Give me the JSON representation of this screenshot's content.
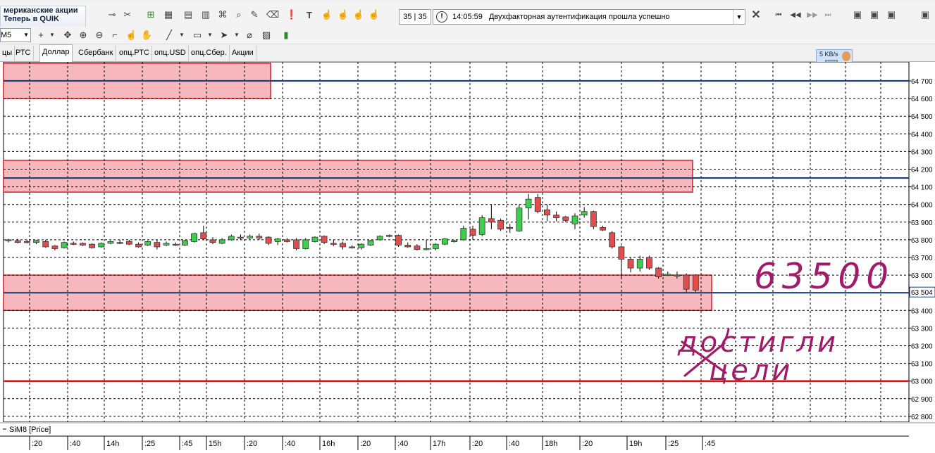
{
  "toolbar": {
    "promo_line1": "мериканские акции",
    "promo_line2": "Теперь в QUIK",
    "counter": "35 | 35",
    "message_time": "14:05:59",
    "message_text": "Двухфакторная аутентификация прошла успешно"
  },
  "toolbar2": {
    "interval": "M5"
  },
  "tabs": [
    "цы",
    "РТС",
    "Доллар",
    "Сбербанк",
    "опц.РТС",
    "опц.USD",
    "опц.Сбер.",
    "Акции"
  ],
  "active_tab": 2,
  "speed_indicator": "5 KB/s",
  "bottom_label": "SiM8 [Price]",
  "price_axis": [
    "64 700",
    "64 600",
    "64 500",
    "64 400",
    "64 300",
    "64 200",
    "64 100",
    "64 000",
    "63 900",
    "63 800",
    "63 700",
    "63 600",
    "63 400",
    "63 300",
    "63 200",
    "63 100",
    "63 000",
    "62 900",
    "62 800"
  ],
  "current_price_label": "63 504",
  "time_axis": [
    ":20",
    ":40",
    "14h",
    ":25",
    ":45",
    "15h",
    ":20",
    ":40",
    "16h",
    ":20",
    ":40",
    "17h",
    ":20",
    ":40",
    "18h",
    ":20",
    "19h",
    ":25",
    ":45"
  ],
  "annotations": {
    "price_note": "63500",
    "text_note_1": "достигли",
    "text_note_2": "цели"
  },
  "chart_data": {
    "type": "candlestick",
    "instrument": "SiM8",
    "ylim": [
      62770,
      64800
    ],
    "levels_blue": [
      64700,
      64150,
      63500
    ],
    "level_red": 63000,
    "zones": [
      {
        "y_top": 64800,
        "y_bottom": 64600
      },
      {
        "y_top": 64250,
        "y_bottom": 64070
      },
      {
        "y_top": 63600,
        "y_bottom": 63400
      }
    ],
    "candles": [
      {
        "o": 63795,
        "h": 63805,
        "l": 63785,
        "c": 63800
      },
      {
        "o": 63795,
        "h": 63805,
        "l": 63780,
        "c": 63785
      },
      {
        "o": 63790,
        "h": 63800,
        "l": 63780,
        "c": 63785
      },
      {
        "o": 63785,
        "h": 63800,
        "l": 63775,
        "c": 63795
      },
      {
        "o": 63790,
        "h": 63800,
        "l": 63755,
        "c": 63760
      },
      {
        "o": 63765,
        "h": 63770,
        "l": 63740,
        "c": 63750
      },
      {
        "o": 63755,
        "h": 63790,
        "l": 63750,
        "c": 63785
      },
      {
        "o": 63780,
        "h": 63790,
        "l": 63770,
        "c": 63775
      },
      {
        "o": 63780,
        "h": 63785,
        "l": 63765,
        "c": 63770
      },
      {
        "o": 63775,
        "h": 63780,
        "l": 63750,
        "c": 63755
      },
      {
        "o": 63760,
        "h": 63785,
        "l": 63755,
        "c": 63780
      },
      {
        "o": 63780,
        "h": 63795,
        "l": 63775,
        "c": 63790
      },
      {
        "o": 63785,
        "h": 63800,
        "l": 63775,
        "c": 63780
      },
      {
        "o": 63790,
        "h": 63800,
        "l": 63770,
        "c": 63775
      },
      {
        "o": 63775,
        "h": 63785,
        "l": 63755,
        "c": 63760
      },
      {
        "o": 63770,
        "h": 63795,
        "l": 63765,
        "c": 63790
      },
      {
        "o": 63785,
        "h": 63800,
        "l": 63745,
        "c": 63760
      },
      {
        "o": 63770,
        "h": 63790,
        "l": 63765,
        "c": 63780
      },
      {
        "o": 63775,
        "h": 63785,
        "l": 63765,
        "c": 63770
      },
      {
        "o": 63770,
        "h": 63800,
        "l": 63765,
        "c": 63795
      },
      {
        "o": 63790,
        "h": 63840,
        "l": 63785,
        "c": 63835
      },
      {
        "o": 63840,
        "h": 63880,
        "l": 63800,
        "c": 63805
      },
      {
        "o": 63800,
        "h": 63815,
        "l": 63775,
        "c": 63785
      },
      {
        "o": 63780,
        "h": 63810,
        "l": 63775,
        "c": 63800
      },
      {
        "o": 63800,
        "h": 63830,
        "l": 63795,
        "c": 63820
      },
      {
        "o": 63815,
        "h": 63830,
        "l": 63800,
        "c": 63810
      },
      {
        "o": 63810,
        "h": 63830,
        "l": 63805,
        "c": 63820
      },
      {
        "o": 63820,
        "h": 63835,
        "l": 63800,
        "c": 63810
      },
      {
        "o": 63815,
        "h": 63820,
        "l": 63770,
        "c": 63780
      },
      {
        "o": 63790,
        "h": 63810,
        "l": 63770,
        "c": 63805
      },
      {
        "o": 63800,
        "h": 63810,
        "l": 63785,
        "c": 63790
      },
      {
        "o": 63800,
        "h": 63810,
        "l": 63740,
        "c": 63750
      },
      {
        "o": 63750,
        "h": 63810,
        "l": 63745,
        "c": 63800
      },
      {
        "o": 63790,
        "h": 63820,
        "l": 63785,
        "c": 63815
      },
      {
        "o": 63820,
        "h": 63825,
        "l": 63775,
        "c": 63785
      },
      {
        "o": 63780,
        "h": 63800,
        "l": 63765,
        "c": 63775
      },
      {
        "o": 63780,
        "h": 63790,
        "l": 63745,
        "c": 63760
      },
      {
        "o": 63760,
        "h": 63770,
        "l": 63750,
        "c": 63755
      },
      {
        "o": 63755,
        "h": 63780,
        "l": 63745,
        "c": 63775
      },
      {
        "o": 63770,
        "h": 63800,
        "l": 63765,
        "c": 63795
      },
      {
        "o": 63800,
        "h": 63825,
        "l": 63795,
        "c": 63820
      },
      {
        "o": 63825,
        "h": 63830,
        "l": 63815,
        "c": 63820
      },
      {
        "o": 63825,
        "h": 63830,
        "l": 63760,
        "c": 63770
      },
      {
        "o": 63770,
        "h": 63785,
        "l": 63755,
        "c": 63760
      },
      {
        "o": 63765,
        "h": 63775,
        "l": 63740,
        "c": 63745
      },
      {
        "o": 63745,
        "h": 63800,
        "l": 63740,
        "c": 63750
      },
      {
        "o": 63750,
        "h": 63780,
        "l": 63740,
        "c": 63775
      },
      {
        "o": 63775,
        "h": 63810,
        "l": 63770,
        "c": 63805
      },
      {
        "o": 63790,
        "h": 63800,
        "l": 63785,
        "c": 63795
      },
      {
        "o": 63800,
        "h": 63880,
        "l": 63795,
        "c": 63865
      },
      {
        "o": 63860,
        "h": 63880,
        "l": 63800,
        "c": 63825
      },
      {
        "o": 63830,
        "h": 63940,
        "l": 63820,
        "c": 63925
      },
      {
        "o": 63920,
        "h": 64000,
        "l": 63860,
        "c": 63900
      },
      {
        "o": 63910,
        "h": 63920,
        "l": 63850,
        "c": 63860
      },
      {
        "o": 63870,
        "h": 63890,
        "l": 63840,
        "c": 63865
      },
      {
        "o": 63850,
        "h": 64000,
        "l": 63845,
        "c": 63980
      },
      {
        "o": 63980,
        "h": 64060,
        "l": 63915,
        "c": 64030
      },
      {
        "o": 64040,
        "h": 64060,
        "l": 63950,
        "c": 63960
      },
      {
        "o": 63970,
        "h": 64000,
        "l": 63905,
        "c": 63940
      },
      {
        "o": 63940,
        "h": 63960,
        "l": 63905,
        "c": 63925
      },
      {
        "o": 63930,
        "h": 63935,
        "l": 63900,
        "c": 63910
      },
      {
        "o": 63890,
        "h": 63950,
        "l": 63860,
        "c": 63935
      },
      {
        "o": 63940,
        "h": 63985,
        "l": 63925,
        "c": 63960
      },
      {
        "o": 63960,
        "h": 63965,
        "l": 63860,
        "c": 63875
      },
      {
        "o": 63870,
        "h": 63880,
        "l": 63850,
        "c": 63855
      },
      {
        "o": 63840,
        "h": 63850,
        "l": 63750,
        "c": 63760
      },
      {
        "o": 63760,
        "h": 63765,
        "l": 63580,
        "c": 63690
      },
      {
        "o": 63690,
        "h": 63700,
        "l": 63615,
        "c": 63640
      },
      {
        "o": 63640,
        "h": 63710,
        "l": 63620,
        "c": 63690
      },
      {
        "o": 63700,
        "h": 63710,
        "l": 63630,
        "c": 63640
      },
      {
        "o": 63640,
        "h": 63645,
        "l": 63580,
        "c": 63590
      },
      {
        "o": 63600,
        "h": 63620,
        "l": 63595,
        "c": 63605
      },
      {
        "o": 63600,
        "h": 63620,
        "l": 63580,
        "c": 63600
      },
      {
        "o": 63600,
        "h": 63610,
        "l": 63505,
        "c": 63520
      },
      {
        "o": 63600,
        "h": 63605,
        "l": 63505,
        "c": 63515
      }
    ]
  }
}
